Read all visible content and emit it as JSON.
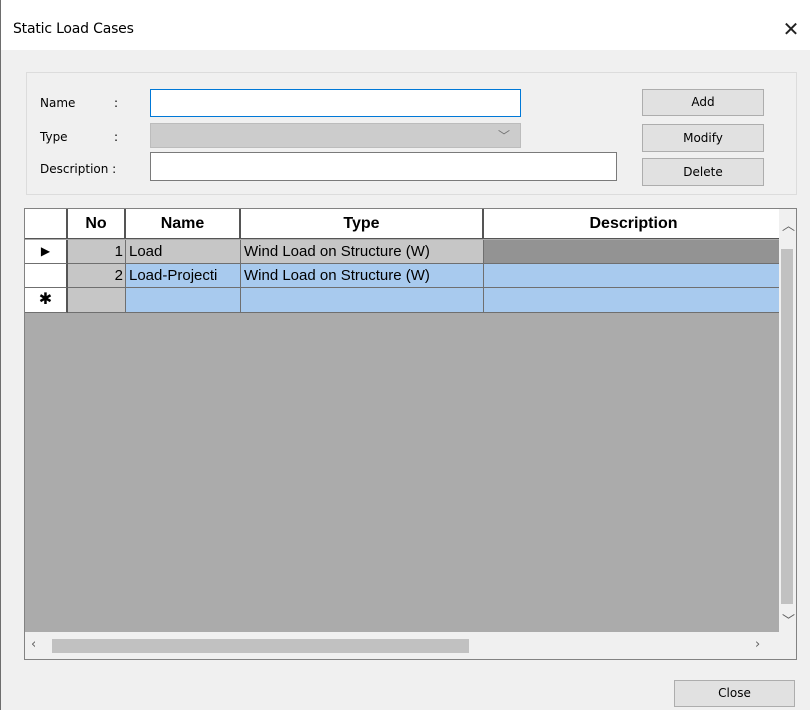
{
  "window": {
    "title": "Static Load Cases"
  },
  "form": {
    "name_label": "Name",
    "type_label": "Type",
    "description_label": "Description :",
    "colon": ":",
    "name_value": "",
    "type_value": "",
    "description_value": ""
  },
  "buttons": {
    "add": "Add",
    "modify": "Modify",
    "delete": "Delete",
    "close": "Close"
  },
  "grid": {
    "columns": [
      "No",
      "Name",
      "Type",
      "Description"
    ],
    "rows": [
      {
        "indicator": "▶",
        "no": "1",
        "name": "Load",
        "type": "Wind Load on Structure (W)",
        "description": ""
      },
      {
        "indicator": "",
        "no": "2",
        "name": "Load-Projecti",
        "type": "Wind Load on Structure (W)",
        "description": ""
      },
      {
        "indicator": "✱",
        "no": "",
        "name": "",
        "type": "",
        "description": ""
      }
    ]
  },
  "icons": {
    "close": "close-icon",
    "dropdown": "chevron-down-icon",
    "current_row": "row-pointer-icon",
    "new_row": "new-row-asterisk-icon"
  }
}
